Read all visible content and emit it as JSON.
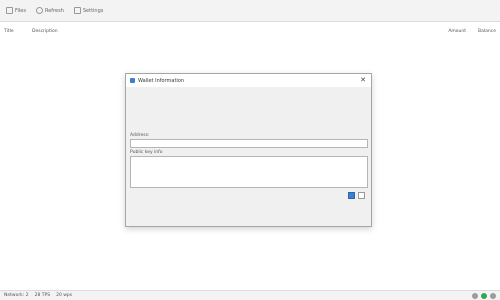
{
  "toolbar": {
    "items": [
      {
        "icon": "document-icon",
        "label": "Files"
      },
      {
        "icon": "refresh-icon",
        "label": "Refresh"
      },
      {
        "icon": "settings-icon",
        "label": "Settings"
      }
    ]
  },
  "columns": {
    "c1": "Title",
    "c2": "Description",
    "c3": "Amount",
    "c4": "Balance"
  },
  "dialog": {
    "title": "Wallet Information",
    "close": "✕",
    "props": [
      {
        "label": "",
        "value": ""
      },
      {
        "label": "",
        "value": ""
      },
      {
        "label": "",
        "value": ""
      },
      {
        "label": "",
        "value": ""
      },
      {
        "label": "",
        "value": ""
      },
      {
        "label": "",
        "value": ""
      }
    ],
    "address_label": "Address:",
    "address_value": "",
    "notes_label": "Public key info",
    "notes_value": ""
  },
  "statusbar": {
    "left1": "Network: 2",
    "left2": "28 TPS",
    "left3": "20 wps"
  }
}
